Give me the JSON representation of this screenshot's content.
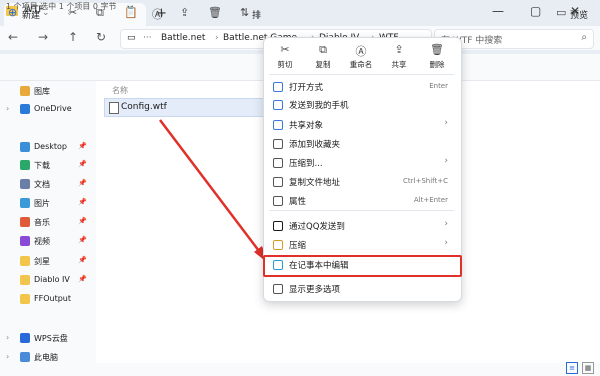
{
  "tab": {
    "title": "WTF",
    "close": "✕",
    "new": "+"
  },
  "window": {
    "minimize": "—",
    "maximize": "▢",
    "close": "✕"
  },
  "nav": {
    "back": "←",
    "forward": "→",
    "up": "↑",
    "refresh": "↻"
  },
  "address": {
    "ellipsis": "···",
    "crumbs": [
      "Battle.net",
      "Battle.net Game",
      "Diablo IV",
      "WTF"
    ],
    "sep": "›"
  },
  "search": {
    "placeholder": "在 WTF 中搜索"
  },
  "toolbar": {
    "new_label": "新建",
    "sort_label": "排",
    "preview_label": "预览"
  },
  "sidebar": {
    "items": [
      {
        "label": "图库",
        "icon": "gallery-icon",
        "color": "#e8a93a",
        "chev": "",
        "pin": ""
      },
      {
        "label": "OneDrive",
        "icon": "cloud-icon",
        "color": "#2a7ad8",
        "chev": "›",
        "pin": ""
      },
      {
        "label": "Desktop",
        "icon": "desktop-icon",
        "color": "#3a8fd8",
        "chev": "",
        "pin": "📌"
      },
      {
        "label": "下载",
        "icon": "download-icon",
        "color": "#2aa86a",
        "chev": "",
        "pin": "📌"
      },
      {
        "label": "文档",
        "icon": "document-icon",
        "color": "#6a7ea8",
        "chev": "",
        "pin": "📌"
      },
      {
        "label": "图片",
        "icon": "picture-icon",
        "color": "#3a9ad8",
        "chev": "",
        "pin": "📌"
      },
      {
        "label": "音乐",
        "icon": "music-icon",
        "color": "#e05a3a",
        "chev": "",
        "pin": "📌"
      },
      {
        "label": "视频",
        "icon": "video-icon",
        "color": "#8a4ad8",
        "chev": "",
        "pin": "📌"
      },
      {
        "label": "剑星",
        "icon": "folder-icon",
        "color": "#f3c64b",
        "chev": "",
        "pin": "📌"
      },
      {
        "label": "Diablo IV",
        "icon": "folder-icon",
        "color": "#f3c64b",
        "chev": "",
        "pin": "📌"
      },
      {
        "label": "FFOutput",
        "icon": "folder-icon",
        "color": "#f3c64b",
        "chev": "",
        "pin": ""
      },
      {
        "label": "WPS云盘",
        "icon": "cloud-icon",
        "color": "#2a6ad8",
        "chev": "›",
        "pin": ""
      },
      {
        "label": "此电脑",
        "icon": "computer-icon",
        "color": "#4a8ad8",
        "chev": "›",
        "pin": ""
      }
    ]
  },
  "content": {
    "column_name": "名称",
    "file": "Config.wtf"
  },
  "status": {
    "text": "1 个项目    选中 1 个项目  0 字节"
  },
  "context_menu": {
    "quick": [
      {
        "label": "剪切",
        "icon": "✂"
      },
      {
        "label": "复制",
        "icon": "⧉"
      },
      {
        "label": "重命名",
        "icon": "Ⓐ"
      },
      {
        "label": "共享",
        "icon": "⇪"
      },
      {
        "label": "删除",
        "icon": "🗑"
      }
    ],
    "items": [
      {
        "label": "打开方式",
        "shortcut": "Enter",
        "arrow": "",
        "icon": "open-with-icon",
        "color": "#3a7ad8"
      },
      {
        "label": "发送到我的手机",
        "shortcut": "",
        "arrow": "",
        "icon": "phone-icon",
        "color": "#3a7ad8"
      },
      {
        "label": "共享对象",
        "shortcut": "",
        "arrow": "›",
        "icon": "share-icon",
        "color": "#3a7ad8"
      },
      {
        "label": "添加到收藏夹",
        "shortcut": "",
        "arrow": "",
        "icon": "star-icon",
        "color": "#555555"
      },
      {
        "label": "压缩到...",
        "shortcut": "",
        "arrow": "›",
        "icon": "compress-icon",
        "color": "#555555"
      },
      {
        "label": "复制文件地址",
        "shortcut": "Ctrl+Shift+C",
        "arrow": "",
        "icon": "copy-path-icon",
        "color": "#555555"
      },
      {
        "label": "属性",
        "shortcut": "Alt+Enter",
        "arrow": "",
        "icon": "properties-icon",
        "color": "#555555"
      },
      {
        "label": "通过QQ发送到",
        "shortcut": "",
        "arrow": "›",
        "icon": "qq-icon",
        "color": "#1a1a1a"
      },
      {
        "label": "压缩",
        "shortcut": "",
        "arrow": "›",
        "icon": "archive-icon",
        "color": "#d89a2a"
      },
      {
        "label": "在记事本中编辑",
        "shortcut": "",
        "arrow": "",
        "icon": "notepad-icon",
        "color": "#2a9ad8"
      },
      {
        "label": "显示更多选项",
        "shortcut": "",
        "arrow": "",
        "icon": "more-options-icon",
        "color": "#555555"
      }
    ]
  },
  "colors": {
    "accent": "#e0302a",
    "selection": "#e3ecf8"
  }
}
